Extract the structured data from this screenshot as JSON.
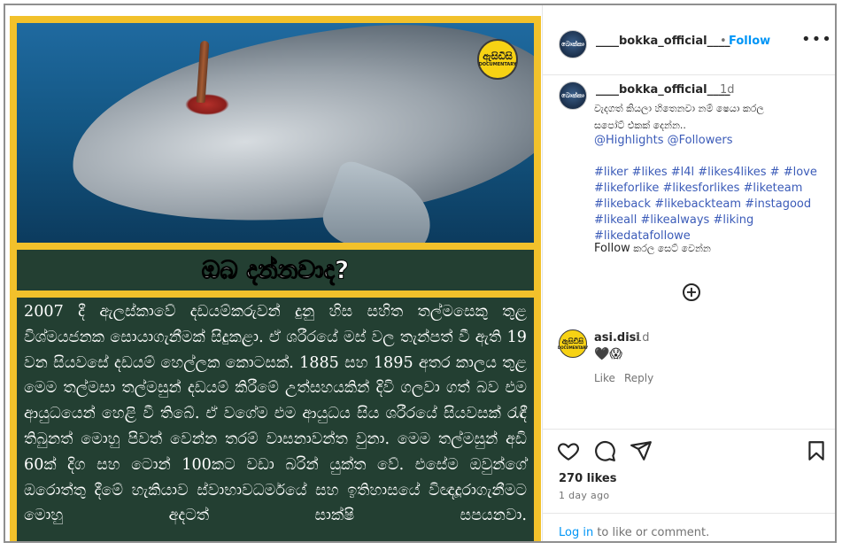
{
  "post_image": {
    "logo_text": "ඇසිඩිසි",
    "logo_subtext": "DOCUMENTARY",
    "title": "ඔබ දන්නවාද?",
    "body_text": "2007 දී ඇලස්කාවේ දඩයම්කරුවන් දුනු හිස සහිත තල්මසෙකු තුළ විශ්මයජනක සොයාගැනීමක් සිදුකළා. ඒ ශරීරයේ මස් වල තැන්පත් වී ඇති 19 වන සියවසේ දඩයම් හෙල්ලක කොටසක්. 1885 සහ 1895 අතර කාලය තුළ මෙම තල්මසා තල්මසුන් දඩයම් කිරීමේ උත්සහයකින් දිවි ගලවා ගත් බව එම ආයුධයෙන් හෙළි වී තිබේ. ඒ වගේම එම ආයුධය සිය ශරීරයේ සියවසක් රැඳී තිබුනත් මොහු පිවත් වෙන්න තරම් වාසනාවන්ත වුනා. මෙම තල්මසුන් අඩි 60ක් දිග සහ ටොන් 100කට වඩා බරින් යුක්ත වේ. එසේම ඔවුන්ගේ ඔරොත්තු දීමේ හැකියාව ස්වාභාවධර්මයේ සහ ඉතිහාසයේ විඥදූරාගැනීමට මොහු අදටත් සාක්ෂි සපයනවා."
  },
  "header": {
    "avatar_text": "බොක්කා",
    "username": "____bokka_official____",
    "separator": "•",
    "follow_label": "Follow",
    "more_label": "•••"
  },
  "caption": {
    "username": "____bokka_official____",
    "time": "1d",
    "line1": "වැදගත් කියලා හිතෙනවා නම් ෂෙයා කරල",
    "line2": "සපෝට් එකක් දෙන්න..",
    "mentions": "@Highlights @Followers",
    "hashtags": [
      "#liker #likes #l4l #likes4likes # #love",
      "#likeforlike #likesforlikes #liketeam",
      "#likeback #likebackteam #instagood",
      "#likeall #likealways #liking",
      "#likedatafollowe"
    ],
    "follow_word": "Follow",
    "follow_rest": " කරල සෙට් වෙන්න"
  },
  "comment": {
    "avatar_text": "ඇසිඩිසි",
    "avatar_subtext": "DOCUMENTARY",
    "username": "asi.disi",
    "time": "1d",
    "text": "🖤😱",
    "like_label": "Like",
    "reply_label": "Reply"
  },
  "engagement": {
    "likes": "270 likes",
    "ago": "1 day ago"
  },
  "footer": {
    "login_label": "Log in",
    "login_rest": " to like or comment."
  },
  "colors": {
    "follow_blue": "#0095f6",
    "hashtag_blue": "#3b5bb8",
    "image_border_yellow": "#f2c12b",
    "band_green": "#233f32"
  }
}
